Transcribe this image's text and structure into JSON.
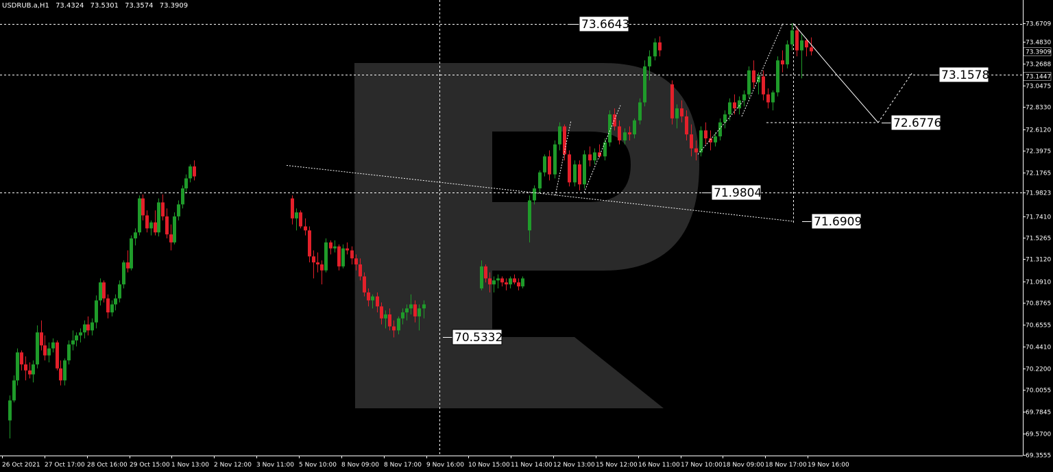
{
  "header": {
    "symbol": "USDRUB.a,H1",
    "open": "73.4324",
    "high": "73.5301",
    "low": "73.3574",
    "close": "73.3909"
  },
  "colors": {
    "background": "#000000",
    "bull": "#1f9b2a",
    "bear": "#e3202a",
    "grid": "#ffffff",
    "text": "#ffffff",
    "watermark": "#2a2a2a"
  },
  "chart_data": {
    "type": "candlestick",
    "grid": false,
    "yticks": [
      "73.6709",
      "73.4830",
      "73.2688",
      "73.0475",
      "72.8330",
      "72.6120",
      "72.3975",
      "72.1765",
      "71.9823",
      "71.7410",
      "71.5265",
      "71.3120",
      "71.0910",
      "70.8765",
      "70.6555",
      "70.4410",
      "70.2200",
      "70.0055",
      "69.7845",
      "69.5700",
      "69.3555"
    ],
    "current_price_labels": [
      "73.3909",
      "73.1447"
    ],
    "xticks": [
      "26 Oct 2021",
      "27 Oct 17:00",
      "28 Oct 16:00",
      "29 Oct 15:00",
      "1 Nov 13:00",
      "2 Nov 12:00",
      "3 Nov 11:00",
      "5 Nov 10:00",
      "8 Nov 09:00",
      "8 Nov 17:00",
      "9 Nov 16:00",
      "10 Nov 15:00",
      "11 Nov 14:00",
      "12 Nov 13:00",
      "15 Nov 12:00",
      "16 Nov 11:00",
      "17 Nov 10:00",
      "18 Nov 09:00",
      "18 Nov 17:00",
      "19 Nov 16:00"
    ],
    "ylim": [
      69.3555,
      73.6709
    ],
    "annotations": {
      "high_level": "73.6643",
      "forecast_target_1": "73.1578",
      "forecast_target_2": "72.6776",
      "mid_level": "71.9804",
      "lower_target": "71.6909",
      "low_level": "70.5332"
    },
    "series": [
      {
        "values": [
          [
            69.7,
            69.95,
            69.52,
            69.9
          ],
          [
            69.9,
            70.15,
            69.88,
            70.1
          ],
          [
            70.1,
            70.42,
            70.05,
            70.38
          ],
          [
            70.38,
            70.4,
            70.2,
            70.26
          ],
          [
            70.26,
            70.34,
            70.1,
            70.2
          ],
          [
            70.2,
            70.28,
            70.12,
            70.16
          ],
          [
            70.16,
            70.3,
            70.08,
            70.26
          ],
          [
            70.26,
            70.65,
            70.22,
            70.58
          ],
          [
            70.58,
            70.7,
            70.4,
            70.45
          ],
          [
            70.45,
            70.55,
            70.3,
            70.35
          ],
          [
            70.35,
            70.48,
            70.28,
            70.42
          ],
          [
            70.42,
            70.52,
            70.38,
            70.48
          ],
          [
            70.48,
            70.5,
            70.2,
            70.22
          ],
          [
            70.22,
            70.3,
            70.05,
            70.1
          ],
          [
            70.1,
            70.32,
            70.05,
            70.3
          ],
          [
            70.3,
            70.5,
            70.26,
            70.46
          ],
          [
            70.46,
            70.6,
            70.4,
            70.5
          ],
          [
            70.5,
            70.58,
            70.44,
            70.55
          ],
          [
            70.55,
            70.62,
            70.48,
            70.58
          ],
          [
            70.58,
            70.7,
            70.52,
            70.66
          ],
          [
            70.66,
            70.74,
            70.55,
            70.6
          ],
          [
            70.6,
            70.72,
            70.55,
            70.68
          ],
          [
            70.68,
            70.95,
            70.62,
            70.9
          ],
          [
            70.9,
            71.12,
            70.85,
            71.08
          ],
          [
            71.08,
            71.1,
            70.88,
            70.92
          ],
          [
            70.92,
            70.96,
            70.72,
            70.78
          ],
          [
            70.78,
            70.9,
            70.74,
            70.86
          ],
          [
            70.86,
            70.96,
            70.8,
            70.92
          ],
          [
            70.92,
            71.1,
            70.88,
            71.06
          ],
          [
            71.06,
            71.3,
            71.02,
            71.28
          ],
          [
            71.28,
            71.4,
            71.18,
            71.22
          ],
          [
            71.22,
            71.55,
            71.2,
            71.52
          ],
          [
            71.52,
            71.62,
            71.45,
            71.58
          ],
          [
            71.58,
            71.95,
            71.55,
            71.92
          ],
          [
            71.92,
            71.96,
            71.7,
            71.75
          ],
          [
            71.75,
            71.8,
            71.58,
            71.62
          ],
          [
            71.62,
            71.7,
            71.55,
            71.68
          ],
          [
            71.68,
            71.8,
            71.55,
            71.58
          ],
          [
            71.58,
            71.92,
            71.54,
            71.88
          ],
          [
            71.88,
            71.96,
            71.7,
            71.74
          ],
          [
            71.74,
            71.82,
            71.52,
            71.56
          ],
          [
            71.56,
            71.66,
            71.4,
            71.48
          ],
          [
            71.48,
            71.78,
            71.46,
            71.74
          ],
          [
            71.74,
            71.9,
            71.7,
            71.86
          ],
          [
            71.86,
            72.05,
            71.82,
            72.02
          ],
          [
            72.02,
            72.16,
            71.98,
            72.12
          ],
          [
            72.12,
            72.26,
            72.08,
            72.24
          ],
          [
            72.24,
            72.3,
            72.1,
            72.14
          ]
        ],
        "start": 14,
        "step": 5.72
      },
      {
        "values": [
          [
            71.92,
            71.95,
            71.66,
            71.72
          ],
          [
            71.72,
            71.82,
            71.6,
            71.78
          ],
          [
            71.78,
            71.8,
            71.62,
            71.64
          ],
          [
            71.64,
            71.72,
            71.55,
            71.6
          ],
          [
            71.6,
            71.64,
            71.28,
            71.34
          ],
          [
            71.34,
            71.4,
            71.12,
            71.28
          ],
          [
            71.28,
            71.38,
            71.18,
            71.26
          ],
          [
            71.26,
            71.3,
            71.06,
            71.2
          ],
          [
            71.2,
            71.52,
            71.18,
            71.48
          ],
          [
            71.48,
            71.5,
            71.36,
            71.42
          ],
          [
            71.42,
            71.5,
            71.38,
            71.44
          ],
          [
            71.44,
            71.46,
            71.2,
            71.24
          ],
          [
            71.24,
            71.46,
            71.22,
            71.42
          ],
          [
            71.42,
            71.48,
            71.36,
            71.4
          ],
          [
            71.4,
            71.44,
            71.26,
            71.32
          ],
          [
            71.32,
            71.36,
            71.2,
            71.26
          ],
          [
            71.26,
            71.32,
            71.1,
            71.14
          ],
          [
            71.14,
            71.18,
            70.94,
            70.98
          ],
          [
            70.98,
            71.02,
            70.84,
            70.9
          ],
          [
            70.9,
            70.96,
            70.82,
            70.94
          ],
          [
            70.94,
            70.98,
            70.78,
            70.84
          ],
          [
            70.84,
            70.88,
            70.66,
            70.72
          ],
          [
            70.72,
            70.8,
            70.62,
            70.76
          ],
          [
            70.76,
            70.82,
            70.6,
            70.64
          ],
          [
            70.64,
            70.7,
            70.53,
            70.6
          ],
          [
            70.6,
            70.74,
            70.56,
            70.72
          ],
          [
            70.72,
            70.82,
            70.66,
            70.78
          ],
          [
            70.78,
            70.86,
            70.7,
            70.82
          ],
          [
            70.82,
            70.96,
            70.76,
            70.86
          ],
          [
            70.86,
            70.9,
            70.68,
            70.74
          ],
          [
            70.74,
            70.86,
            70.6,
            70.82
          ],
          [
            70.82,
            70.9,
            70.72,
            70.86
          ]
        ],
        "start": 426,
        "step": 6.18
      },
      {
        "values": [
          [
            71.02,
            71.3,
            71.0,
            71.24
          ],
          [
            71.24,
            71.26,
            71.08,
            71.12
          ],
          [
            71.12,
            71.18,
            70.98,
            71.06
          ],
          [
            71.06,
            71.14,
            70.98,
            71.1
          ],
          [
            71.1,
            71.16,
            71.02,
            71.12
          ],
          [
            71.12,
            71.14,
            71.04,
            71.08
          ],
          [
            71.08,
            71.12,
            71.0,
            71.06
          ],
          [
            71.06,
            71.14,
            71.02,
            71.12
          ],
          [
            71.12,
            71.16,
            71.06,
            71.08
          ],
          [
            71.08,
            71.12,
            71.0,
            71.04
          ],
          [
            71.04,
            71.14,
            71.02,
            71.12
          ]
        ],
        "start": 702,
        "step": 6.0
      },
      {
        "values": [
          [
            71.6,
            71.95,
            71.48,
            71.9
          ],
          [
            71.9,
            72.05,
            71.86,
            72.02
          ],
          [
            72.02,
            72.2,
            71.98,
            72.18
          ],
          [
            72.18,
            72.36,
            72.14,
            72.34
          ],
          [
            72.34,
            72.4,
            72.1,
            72.16
          ],
          [
            72.16,
            72.5,
            72.12,
            72.46
          ],
          [
            72.46,
            72.68,
            72.4,
            72.64
          ],
          [
            72.64,
            72.66,
            72.3,
            72.36
          ],
          [
            72.36,
            72.4,
            72.04,
            72.08
          ],
          [
            72.08,
            72.3,
            72.04,
            72.26
          ],
          [
            72.26,
            72.3,
            72.0,
            72.06
          ],
          [
            72.06,
            72.4,
            72.02,
            72.36
          ],
          [
            72.36,
            72.44,
            72.24,
            72.3
          ],
          [
            72.3,
            72.42,
            72.26,
            72.38
          ],
          [
            72.38,
            72.46,
            72.32,
            72.34
          ],
          [
            72.34,
            72.52,
            72.3,
            72.48
          ],
          [
            72.48,
            72.8,
            72.44,
            72.76
          ],
          [
            72.76,
            72.82,
            72.6,
            72.64
          ],
          [
            72.64,
            72.7,
            72.46,
            72.5
          ],
          [
            72.5,
            72.62,
            72.46,
            72.58
          ],
          [
            72.58,
            72.64,
            72.5,
            72.56
          ],
          [
            72.56,
            72.72,
            72.52,
            72.7
          ],
          [
            72.7,
            72.92,
            72.66,
            72.88
          ],
          [
            72.88,
            73.3,
            72.84,
            73.24
          ],
          [
            73.24,
            73.4,
            73.1,
            73.34
          ],
          [
            73.34,
            73.52,
            73.3,
            73.48
          ],
          [
            73.48,
            73.54,
            73.34,
            73.4
          ]
        ],
        "start": 772,
        "step": 7.3
      },
      {
        "values": [
          [
            73.06,
            73.1,
            72.66,
            72.72
          ],
          [
            72.72,
            72.86,
            72.62,
            72.82
          ],
          [
            72.82,
            72.9,
            72.68,
            72.74
          ],
          [
            72.74,
            72.8,
            72.5,
            72.56
          ],
          [
            72.56,
            72.66,
            72.34,
            72.42
          ],
          [
            72.42,
            72.5,
            72.3,
            72.38
          ],
          [
            72.38,
            72.64,
            72.34,
            72.6
          ],
          [
            72.6,
            72.68,
            72.46,
            72.52
          ],
          [
            72.52,
            72.6,
            72.4,
            72.48
          ],
          [
            72.48,
            72.58,
            72.44,
            72.54
          ],
          [
            72.54,
            72.72,
            72.5,
            72.68
          ],
          [
            72.68,
            72.8,
            72.62,
            72.76
          ],
          [
            72.76,
            72.92,
            72.7,
            72.88
          ],
          [
            72.88,
            72.96,
            72.76,
            72.82
          ],
          [
            72.82,
            72.94,
            72.76,
            72.9
          ],
          [
            72.9,
            73.0,
            72.84,
            72.96
          ],
          [
            72.96,
            73.24,
            72.92,
            73.2
          ],
          [
            73.2,
            73.3,
            73.02,
            73.08
          ],
          [
            73.08,
            73.18,
            72.96,
            73.14
          ],
          [
            73.14,
            73.2,
            72.9,
            72.96
          ],
          [
            72.96,
            73.02,
            72.82,
            72.88
          ],
          [
            72.88,
            73.0,
            72.8,
            72.98
          ],
          [
            72.98,
            73.34,
            72.94,
            73.3
          ],
          [
            73.3,
            73.4,
            73.18,
            73.26
          ],
          [
            73.26,
            73.5,
            73.22,
            73.46
          ],
          [
            73.46,
            73.67,
            73.4,
            73.6
          ],
          [
            73.6,
            73.64,
            73.34,
            73.4
          ],
          [
            73.4,
            73.56,
            73.12,
            73.5
          ],
          [
            73.5,
            73.52,
            73.34,
            73.43
          ],
          [
            73.43,
            73.53,
            73.35,
            73.39
          ]
        ],
        "start": 980,
        "step": 7.0
      }
    ]
  }
}
